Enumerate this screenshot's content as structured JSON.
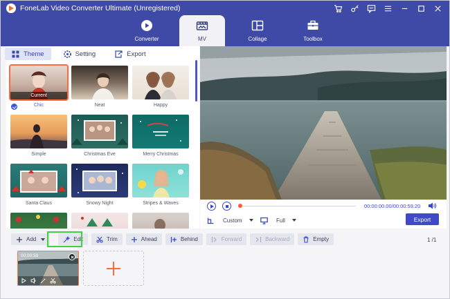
{
  "app": {
    "title": "FoneLab Video Converter Ultimate (Unregistered)"
  },
  "window_icons": [
    "cart-icon",
    "key-icon",
    "chat-icon",
    "menu-icon",
    "minimize-icon",
    "maximize-icon",
    "close-icon"
  ],
  "nav": {
    "tabs": [
      {
        "label": "Converter",
        "icon": "converter-icon",
        "active": false
      },
      {
        "label": "MV",
        "icon": "mv-icon",
        "active": true
      },
      {
        "label": "Collage",
        "icon": "collage-icon",
        "active": false
      },
      {
        "label": "Toolbox",
        "icon": "toolbox-icon",
        "active": false
      }
    ]
  },
  "subtabs": [
    {
      "label": "Theme",
      "icon": "grid-icon",
      "active": true
    },
    {
      "label": "Setting",
      "icon": "gear-icon",
      "active": false
    },
    {
      "label": "Export",
      "icon": "export-icon",
      "active": false
    }
  ],
  "themes": [
    {
      "label": "Chic",
      "selected": true,
      "badge": "Current"
    },
    {
      "label": "Neat"
    },
    {
      "label": "Happy"
    },
    {
      "label": "Simple"
    },
    {
      "label": "Christmas Eve"
    },
    {
      "label": "Merry Christmas"
    },
    {
      "label": "Santa Claus"
    },
    {
      "label": "Snowy Night"
    },
    {
      "label": "Stripes & Waves"
    },
    {
      "label": ""
    },
    {
      "label": ""
    },
    {
      "label": ""
    }
  ],
  "player": {
    "time": "00:00:00.00/00:00:59.20",
    "aspect_label": "Custom",
    "view_label": "Full",
    "export_label": "Export",
    "progress_fraction": 0.0
  },
  "toolbar": {
    "add_label": "Add",
    "edit_label": "Edit",
    "trim_label": "Trim",
    "ahead_label": "Ahead",
    "behind_label": "Behind",
    "forward_label": "Forward",
    "backward_label": "Backward",
    "empty_label": "Empty",
    "page_counter": "1 /1"
  },
  "clip": {
    "duration": "00:00:59"
  },
  "colors": {
    "accent": "#3f4aa6",
    "highlight": "#ff6a3d",
    "edit_frame": "#3fd23a"
  }
}
